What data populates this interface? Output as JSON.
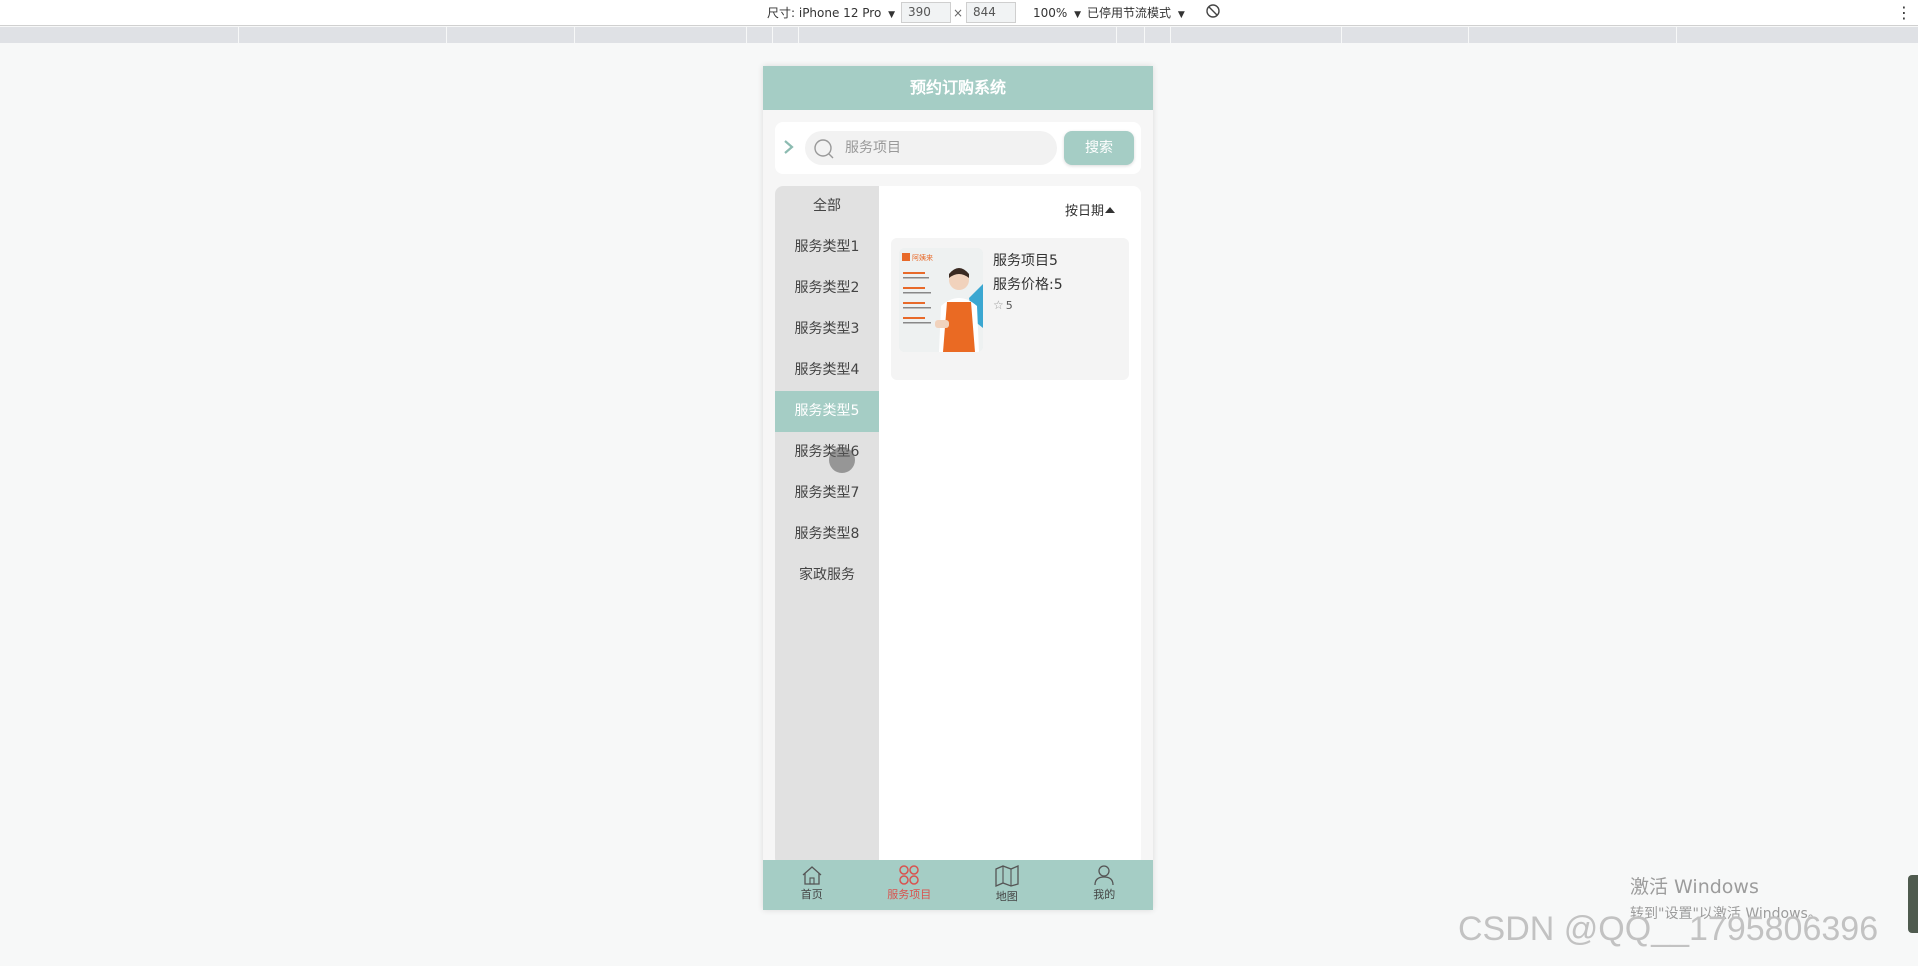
{
  "devtools": {
    "size_label": "尺寸: iPhone 12 Pro",
    "width": "390",
    "times": "×",
    "height": "844",
    "zoom": "100%",
    "throttle": "已停用节流模式",
    "dropdown_glyph": "▼",
    "more_glyph": "⋮"
  },
  "app": {
    "title": "预约订购系统",
    "search": {
      "placeholder": "服务项目",
      "button": "搜索"
    },
    "categories": [
      {
        "label": "全部"
      },
      {
        "label": "服务类型1"
      },
      {
        "label": "服务类型2"
      },
      {
        "label": "服务类型3"
      },
      {
        "label": "服务类型4"
      },
      {
        "label": "服务类型5"
      },
      {
        "label": "服务类型6"
      },
      {
        "label": "服务类型7"
      },
      {
        "label": "服务类型8"
      },
      {
        "label": "家政服务"
      }
    ],
    "active_category": "服务类型5",
    "sort_label": "按日期",
    "products": [
      {
        "name": "服务项目5",
        "price": "服务价格:5",
        "rating": "5",
        "image_brand": "阿姨来"
      }
    ],
    "tabs": [
      {
        "label": "首页",
        "icon": "home-icon"
      },
      {
        "label": "服务项目",
        "icon": "grid-icon"
      },
      {
        "label": "地图",
        "icon": "map-icon"
      },
      {
        "label": "我的",
        "icon": "user-icon"
      }
    ],
    "active_tab": "服务项目",
    "colors": {
      "accent": "#a5cdc5",
      "active_tab": "#d9534f",
      "sidebar_bg": "#e1e1e1"
    }
  },
  "watermark": {
    "line1": "激活 Windows",
    "line2": "转到\"设置\"以激活 Windows。",
    "csdn": "CSDN @QQ__1795806396"
  }
}
